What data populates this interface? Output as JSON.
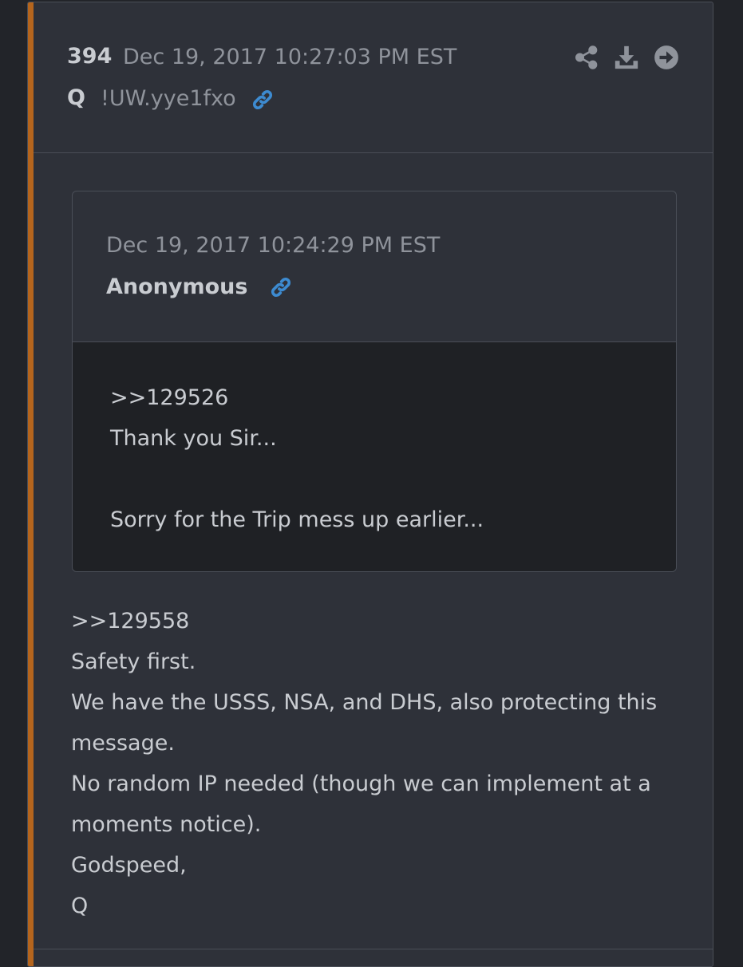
{
  "post": {
    "number": "394",
    "timestamp": "Dec 19, 2017 10:27:03 PM EST",
    "author": "Q",
    "tripcode": "!UW.yye1fxo",
    "link_icon": "link-icon",
    "actions": [
      {
        "name": "share",
        "icon": "share-icon"
      },
      {
        "name": "download",
        "icon": "download-icon"
      },
      {
        "name": "go",
        "icon": "arrow-right-circle-icon"
      }
    ],
    "accent_color": "#b5651d",
    "link_color": "#3d8bd1"
  },
  "quoted": {
    "timestamp": "Dec 19, 2017 10:24:29 PM EST",
    "author": "Anonymous",
    "lines": [
      ">>129526",
      "Thank you Sir...",
      "",
      "Sorry for the Trip mess up earlier..."
    ]
  },
  "body": {
    "lines": [
      ">>129558",
      "Safety first.",
      "We have the USSS, NSA, and DHS, also protecting this",
      "message.",
      "No random IP needed (though we can implement at a",
      "moments notice).",
      "Godspeed,",
      "Q"
    ]
  }
}
